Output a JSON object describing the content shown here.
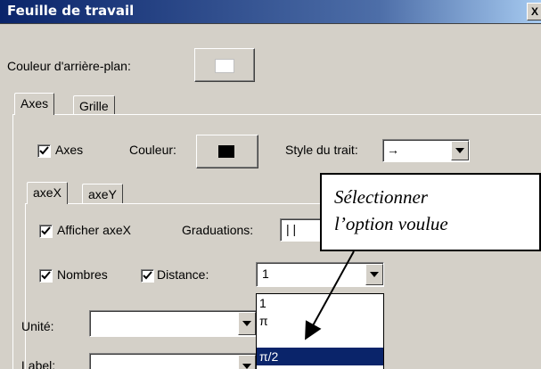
{
  "window": {
    "title": "Feuille de travail",
    "close_label": "X"
  },
  "background": {
    "label": "Couleur d'arrière-plan:",
    "color": "#ffffff"
  },
  "tabs": [
    "Axes",
    "Grille"
  ],
  "axes": {
    "checkbox_label": "Axes",
    "checked": true,
    "color_label": "Couleur:",
    "color": "#000000",
    "line_style_label": "Style du trait:",
    "line_style_value": "→"
  },
  "axis_tabs": [
    "axeX",
    "axeY"
  ],
  "axeX": {
    "show_label": "Afficher axeX",
    "show_checked": true,
    "ticks_label": "Graduations:",
    "ticks_value": "|   |",
    "numbers_label": "Nombres",
    "numbers_checked": true,
    "distance_label": "Distance:",
    "distance_checked": true,
    "distance_value": "1",
    "distance_options": [
      "1",
      "π",
      "π/2"
    ],
    "distance_selected": "π/2",
    "unit_label": "Unité:",
    "unit_value": "",
    "label_label": "Label:",
    "label_value": ""
  },
  "callout": {
    "line1": "Sélectionner",
    "line2": "l’option voulue"
  }
}
